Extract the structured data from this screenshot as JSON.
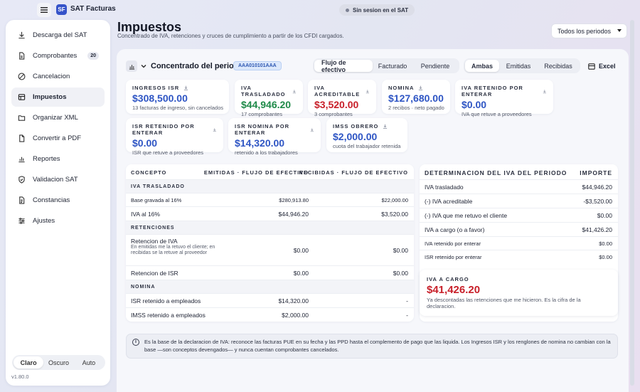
{
  "app": {
    "logo": "SF",
    "name": "SAT Facturas",
    "session": "Sin sesion en el SAT"
  },
  "sidebar": {
    "items": [
      {
        "label": "Descarga del SAT",
        "icon": "download-icon"
      },
      {
        "label": "Comprobantes",
        "icon": "document-icon",
        "badge": "20"
      },
      {
        "label": "Cancelacion",
        "icon": "cancel-circle-icon"
      },
      {
        "label": "Impuestos",
        "icon": "table-icon"
      },
      {
        "label": "Organizar XML",
        "icon": "folder-icon"
      },
      {
        "label": "Convertir a PDF",
        "icon": "file-icon"
      },
      {
        "label": "Reportes",
        "icon": "bar-chart-icon"
      },
      {
        "label": "Validacion SAT",
        "icon": "shield-icon"
      },
      {
        "label": "Constancias",
        "icon": "file-text-icon"
      },
      {
        "label": "Ajustes",
        "icon": "sliders-icon"
      }
    ],
    "theme": {
      "options": [
        "Claro",
        "Oscuro",
        "Auto"
      ],
      "selected": "Claro"
    },
    "version": "v1.80.0"
  },
  "header": {
    "title": "Impuestos",
    "subtitle": "Concentrado de IVA, retenciones y cruces de cumplimiento a partir de los CFDI cargados.",
    "period": "Todos los periodos"
  },
  "section": {
    "title": "Concentrado del periodo",
    "rfc": "AAA010101AAA",
    "views": [
      "Flujo de efectivo",
      "Facturado",
      "Pendiente"
    ],
    "view_selected": "Flujo de efectivo",
    "scopes": [
      "Ambas",
      "Emitidas",
      "Recibidas"
    ],
    "scope_selected": "Ambas",
    "excel_label": "Excel"
  },
  "kpis": [
    {
      "label": "INGRESOS ISR",
      "value": "$308,500.00",
      "sub": "13 facturas de ingreso, sin cancelados",
      "color": "#2e55c4"
    },
    {
      "label": "IVA TRASLADADO",
      "value": "$44,946.20",
      "sub": "17 comprobantes",
      "color": "#1f8a49"
    },
    {
      "label": "IVA ACREDITABLE",
      "value": "$3,520.00",
      "sub": "3 comprobantes",
      "color": "#c8202a"
    },
    {
      "label": "NOMINA",
      "value": "$127,680.00",
      "sub": "2 recibos · neto pagado",
      "color": "#2e55c4"
    },
    {
      "label": "IVA RETENIDO POR ENTERAR",
      "value": "$0.00",
      "sub": "IVA que retuve a proveedores",
      "color": "#2e55c4"
    },
    {
      "label": "ISR RETENIDO POR ENTERAR",
      "value": "$0.00",
      "sub": "ISR que retuve a proveedores",
      "color": "#2e55c4"
    },
    {
      "label": "ISR NOMINA POR ENTERAR",
      "value": "$14,320.00",
      "sub": "retenido a los trabajadores",
      "color": "#2e55c4"
    },
    {
      "label": "IMSS OBRERO",
      "value": "$2,000.00",
      "sub": "cuota del trabajador retenida",
      "color": "#2e55c4"
    }
  ],
  "flow_table": {
    "headers": [
      "CONCEPTO",
      "EMITIDAS · FLUJO DE EFECTIVO",
      "RECIBIDAS · FLUJO DE EFECTIVO"
    ],
    "rows": [
      {
        "type": "group",
        "concept": "IVA TRASLADADO"
      },
      {
        "type": "row",
        "concept": "Base gravada al 16%",
        "emitidas": "$280,913.80",
        "recibidas": "$22,000.00"
      },
      {
        "type": "row",
        "concept": "IVA al 16%",
        "emitidas": "$44,946.20",
        "recibidas": "$3,520.00"
      },
      {
        "type": "group",
        "concept": "RETENCIONES"
      },
      {
        "type": "row",
        "concept": "Retencion de IVA",
        "note": "En emitidas me la retuvo el cliente; en recibidas se la retuve al proveedor",
        "emitidas": "$0.00",
        "recibidas": "$0.00"
      },
      {
        "type": "row",
        "concept": "Retencion de ISR",
        "emitidas": "$0.00",
        "recibidas": "$0.00"
      },
      {
        "type": "group",
        "concept": "NOMINA"
      },
      {
        "type": "row",
        "concept": "ISR retenido a empleados",
        "emitidas": "$14,320.00",
        "recibidas": "-"
      },
      {
        "type": "row",
        "concept": "IMSS retenido a empleados",
        "emitidas": "$2,000.00",
        "recibidas": "-"
      }
    ]
  },
  "iva_table": {
    "headers": [
      "DETERMINACION DEL IVA DEL PERIODO",
      "IMPORTE"
    ],
    "rows": [
      {
        "concept": "IVA trasladado",
        "amount": "$44,946.20"
      },
      {
        "concept": "(-) IVA acreditable",
        "amount": "-$3,520.00"
      },
      {
        "concept": "(-) IVA que me retuvo el cliente",
        "amount": "$0.00"
      },
      {
        "concept": "IVA a cargo (o a favor)",
        "amount": "$41,426.20"
      },
      {
        "concept": "IVA retenido por enterar",
        "amount": "$0.00"
      },
      {
        "concept": "ISR retenido por enterar",
        "amount": "$0.00"
      }
    ]
  },
  "summary": {
    "label": "IVA A CARGO",
    "value": "$41,426.20",
    "note": "Ya descontadas las retenciones que me hicieron. Es la cifra de la declaracion.",
    "color": "#c8202a"
  },
  "info_note": "Es la base de la declaracion de IVA: reconoce las facturas PUE en su fecha y las PPD hasta el complemento de pago que las liquida. Los Ingresos ISR y los renglones de nomina no cambian con la base —son conceptos devengados— y nunca cuentan comprobantes cancelados."
}
